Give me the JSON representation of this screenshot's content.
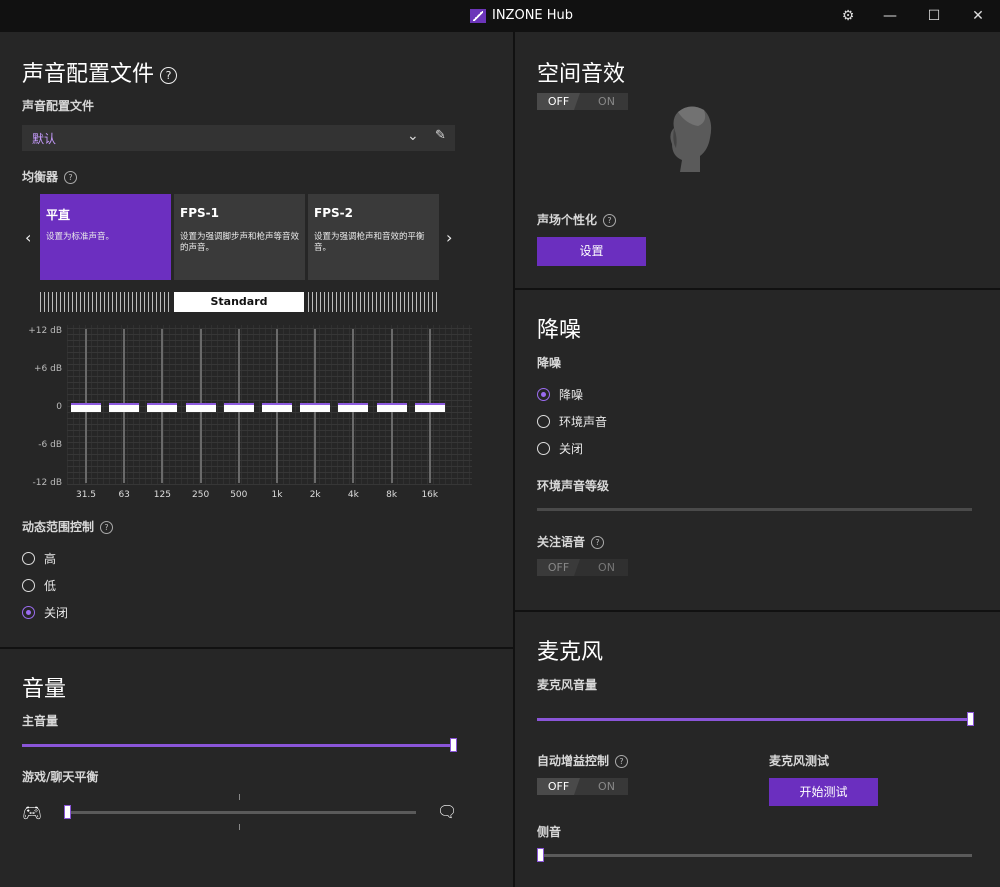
{
  "app_title": "INZONE Hub",
  "sound_profile": {
    "heading": "声音配置文件",
    "profile_label": "声音配置文件",
    "profile_value": "默认",
    "eq_label": "均衡器",
    "presets": [
      {
        "name": "平直",
        "desc": "设置为标准声音。"
      },
      {
        "name": "FPS-1",
        "desc": "设置为强调脚步声和枪声等音效的声音。"
      },
      {
        "name": "FPS-2",
        "desc": "设置为强调枪声和音效的平衡音。"
      }
    ],
    "preset_bar_label": "Standard",
    "db_labels": [
      "+12 dB",
      "+6 dB",
      "0",
      "-6 dB",
      "-12 dB"
    ],
    "bands": [
      {
        "freq": "31.5",
        "gain_db": 0
      },
      {
        "freq": "63",
        "gain_db": 0
      },
      {
        "freq": "125",
        "gain_db": 0
      },
      {
        "freq": "250",
        "gain_db": 0
      },
      {
        "freq": "500",
        "gain_db": 0
      },
      {
        "freq": "1k",
        "gain_db": 0
      },
      {
        "freq": "2k",
        "gain_db": 0
      },
      {
        "freq": "4k",
        "gain_db": 0
      },
      {
        "freq": "8k",
        "gain_db": 0
      },
      {
        "freq": "16k",
        "gain_db": 0
      }
    ],
    "drc_label": "动态范围控制",
    "drc_options": [
      "高",
      "低",
      "关闭"
    ],
    "drc_selected": 2
  },
  "volume": {
    "heading": "音量",
    "master_label": "主音量",
    "master_level": 1.0,
    "balance_label": "游戏/聊天平衡",
    "balance_level": 0.0
  },
  "spatial": {
    "heading": "空间音效",
    "toggle_off": "OFF",
    "toggle_on": "ON",
    "toggle_state": "OFF",
    "personal_label": "声场个性化",
    "settings_button": "设置"
  },
  "nc": {
    "heading": "降噪",
    "sub_label": "降噪",
    "options": [
      "降噪",
      "环境声音",
      "关闭"
    ],
    "selected": 0,
    "ambient_label": "环境声音等级",
    "focus_label": "关注语音",
    "toggle_off": "OFF",
    "toggle_on": "ON"
  },
  "mic": {
    "heading": "麦克风",
    "volume_label": "麦克风音量",
    "volume_level": 1.0,
    "agc_label": "自动增益控制",
    "agc_off": "OFF",
    "agc_on": "ON",
    "test_label": "麦克风测试",
    "test_button": "开始测试",
    "sidetone_label": "侧音",
    "sidetone_level": 0.0
  },
  "colors": {
    "accent": "#6b2fbf",
    "accent_light": "#9b6cf0",
    "panel": "#262626"
  },
  "icons": [
    "settings-gear-icon",
    "minimize-icon",
    "maximize-icon",
    "close-icon",
    "gamepad-icon",
    "chat-icon",
    "edit-pencil-icon",
    "chevron-down-icon"
  ]
}
